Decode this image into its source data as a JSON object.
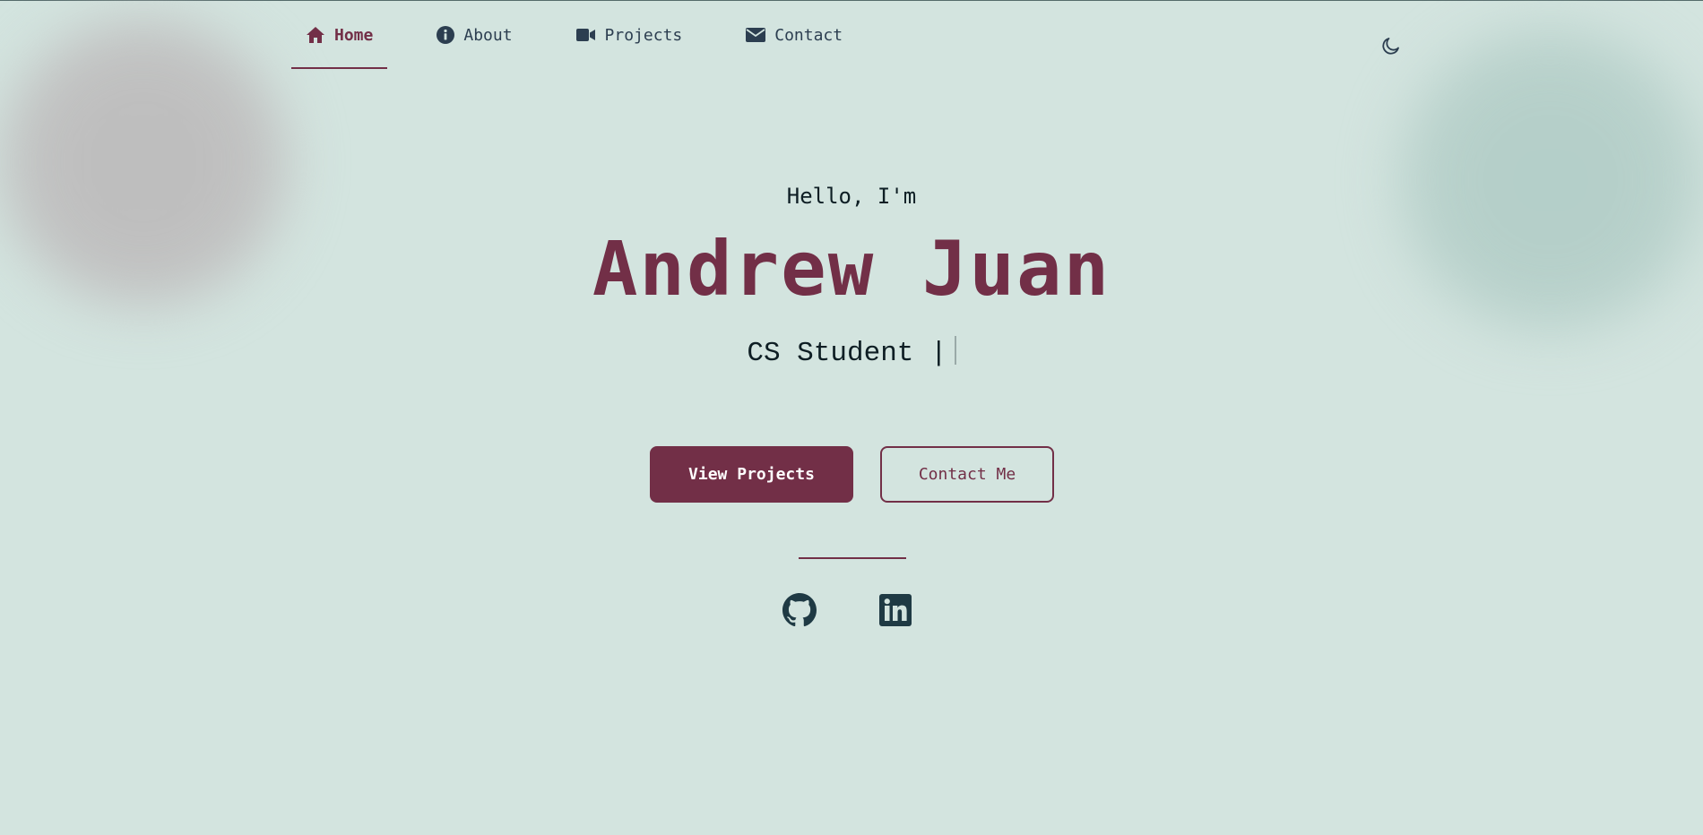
{
  "nav": {
    "items": [
      {
        "label": "Home",
        "icon": "home-icon",
        "active": true
      },
      {
        "label": "About",
        "icon": "info-icon",
        "active": false
      },
      {
        "label": "Projects",
        "icon": "video-icon",
        "active": false
      },
      {
        "label": "Contact",
        "icon": "envelope-icon",
        "active": false
      }
    ],
    "theme_toggle_icon": "moon-icon"
  },
  "hero": {
    "greeting": "Hello, I'm",
    "name": "Andrew Juan",
    "role": "CS Student |"
  },
  "buttons": {
    "primary_label": "View Projects",
    "secondary_label": "Contact Me"
  },
  "socials": [
    {
      "icon": "github-icon"
    },
    {
      "icon": "linkedin-icon"
    }
  ],
  "colors": {
    "background": "#d3e4df",
    "accent": "#722f47",
    "text": "#0e1e24",
    "nav_text": "#2c3e50"
  }
}
